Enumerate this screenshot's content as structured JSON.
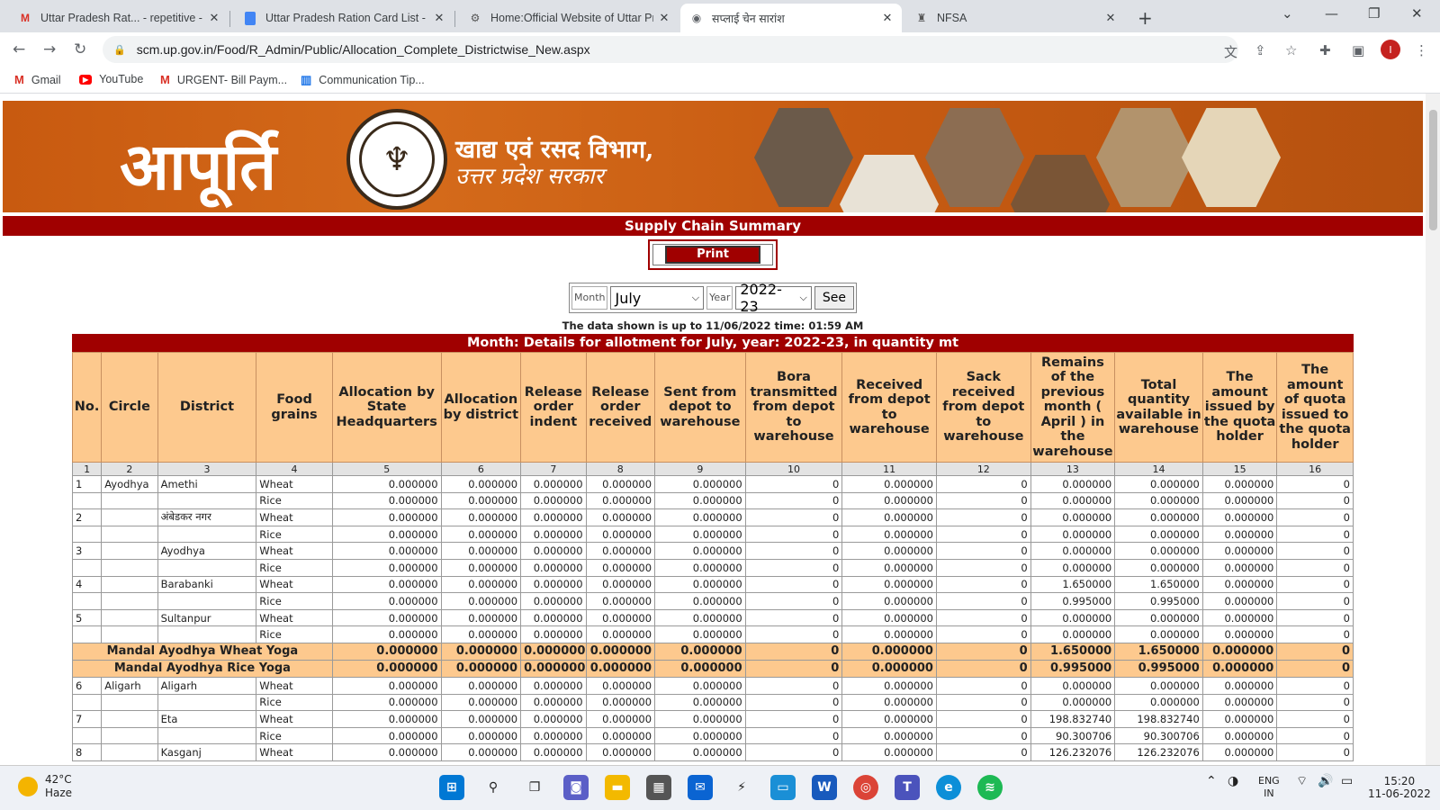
{
  "browser": {
    "tabs": [
      {
        "title": "Uttar Pradesh Rat... - repetitive -",
        "icon": "gmail-icon",
        "active": false
      },
      {
        "title": "Uttar Pradesh Ration Card List - C",
        "icon": "docs-icon",
        "active": false
      },
      {
        "title": "Home:Official Website of Uttar Pr",
        "icon": "emblem-icon",
        "active": false
      },
      {
        "title": "सप्लाई चेन सारांश",
        "icon": "globe-icon",
        "active": true
      },
      {
        "title": "NFSA",
        "icon": "emblem-icon",
        "active": false
      }
    ],
    "url": "scm.up.gov.in/Food/R_Admin/Public/Allocation_Complete_Districtwise_New.aspx",
    "profile_initial": "I",
    "bookmarks": [
      {
        "label": "Gmail",
        "icon": "gmail-icon"
      },
      {
        "label": "YouTube",
        "icon": "youtube-icon"
      },
      {
        "label": "URGENT- Bill Paym...",
        "icon": "gmail-icon"
      },
      {
        "label": "Communication Tip...",
        "icon": "chart-icon"
      }
    ]
  },
  "banner": {
    "logo_text": "आपूर्ति",
    "dept_line1": "खाद्य एवं रसद विभाग,",
    "dept_line2": "उत्तर प्रदेश सरकार"
  },
  "page": {
    "title": "Supply Chain Summary",
    "print_label": "Print",
    "month_label": "Month",
    "month_value": "July",
    "year_label": "Year",
    "year_value": "2022-23",
    "see_label": "See",
    "as_of": "The data shown is up to 11/06/2022 time: 01:59 AM",
    "table_caption": "Month: Details for allotment for July, year: 2022-23, in quantity mt"
  },
  "table": {
    "headers": [
      "No.",
      "Circle",
      "District",
      "Food grains",
      "Allocation by State Headquarters",
      "Allocation by district",
      "Release order indent",
      "Release order received",
      "Sent from depot to warehouse",
      "Bora transmitted from depot to warehouse",
      "Received from depot to warehouse",
      "Sack received from depot to warehouse",
      "Remains of the previous month ( April ) in the warehouse",
      "Total quantity available in warehouse",
      "The amount issued by the quota holder",
      "The amount of quota issued to the quota holder"
    ],
    "col_numbers": [
      "1",
      "2",
      "3",
      "4",
      "5",
      "6",
      "7",
      "8",
      "9",
      "10",
      "11",
      "12",
      "13",
      "14",
      "15",
      "16"
    ],
    "rows": [
      {
        "type": "data",
        "cells": [
          "1",
          "Ayodhya",
          "Amethi",
          "Wheat",
          "0.000000",
          "0.000000",
          "0.000000",
          "0.000000",
          "0.000000",
          "0",
          "0.000000",
          "0",
          "0.000000",
          "0.000000",
          "0.000000",
          "0"
        ]
      },
      {
        "type": "data",
        "cells": [
          "",
          "",
          "",
          "Rice",
          "0.000000",
          "0.000000",
          "0.000000",
          "0.000000",
          "0.000000",
          "0",
          "0.000000",
          "0",
          "0.000000",
          "0.000000",
          "0.000000",
          "0"
        ]
      },
      {
        "type": "data",
        "cells": [
          "2",
          "",
          "अंबेडकर नगर",
          "Wheat",
          "0.000000",
          "0.000000",
          "0.000000",
          "0.000000",
          "0.000000",
          "0",
          "0.000000",
          "0",
          "0.000000",
          "0.000000",
          "0.000000",
          "0"
        ]
      },
      {
        "type": "data",
        "cells": [
          "",
          "",
          "",
          "Rice",
          "0.000000",
          "0.000000",
          "0.000000",
          "0.000000",
          "0.000000",
          "0",
          "0.000000",
          "0",
          "0.000000",
          "0.000000",
          "0.000000",
          "0"
        ]
      },
      {
        "type": "data",
        "cells": [
          "3",
          "",
          "Ayodhya",
          "Wheat",
          "0.000000",
          "0.000000",
          "0.000000",
          "0.000000",
          "0.000000",
          "0",
          "0.000000",
          "0",
          "0.000000",
          "0.000000",
          "0.000000",
          "0"
        ]
      },
      {
        "type": "data",
        "cells": [
          "",
          "",
          "",
          "Rice",
          "0.000000",
          "0.000000",
          "0.000000",
          "0.000000",
          "0.000000",
          "0",
          "0.000000",
          "0",
          "0.000000",
          "0.000000",
          "0.000000",
          "0"
        ]
      },
      {
        "type": "data",
        "cells": [
          "4",
          "",
          "Barabanki",
          "Wheat",
          "0.000000",
          "0.000000",
          "0.000000",
          "0.000000",
          "0.000000",
          "0",
          "0.000000",
          "0",
          "1.650000",
          "1.650000",
          "0.000000",
          "0"
        ]
      },
      {
        "type": "data",
        "cells": [
          "",
          "",
          "",
          "Rice",
          "0.000000",
          "0.000000",
          "0.000000",
          "0.000000",
          "0.000000",
          "0",
          "0.000000",
          "0",
          "0.995000",
          "0.995000",
          "0.000000",
          "0"
        ]
      },
      {
        "type": "data",
        "cells": [
          "5",
          "",
          "Sultanpur",
          "Wheat",
          "0.000000",
          "0.000000",
          "0.000000",
          "0.000000",
          "0.000000",
          "0",
          "0.000000",
          "0",
          "0.000000",
          "0.000000",
          "0.000000",
          "0"
        ]
      },
      {
        "type": "data",
        "cells": [
          "",
          "",
          "",
          "Rice",
          "0.000000",
          "0.000000",
          "0.000000",
          "0.000000",
          "0.000000",
          "0",
          "0.000000",
          "0",
          "0.000000",
          "0.000000",
          "0.000000",
          "0"
        ]
      },
      {
        "type": "sum",
        "label": "Mandal Ayodhya Wheat Yoga",
        "cells": [
          "0.000000",
          "0.000000",
          "0.000000",
          "0.000000",
          "0.000000",
          "0",
          "0.000000",
          "0",
          "1.650000",
          "1.650000",
          "0.000000",
          "0"
        ]
      },
      {
        "type": "sum",
        "label": "Mandal Ayodhya Rice Yoga",
        "cells": [
          "0.000000",
          "0.000000",
          "0.000000",
          "0.000000",
          "0.000000",
          "0",
          "0.000000",
          "0",
          "0.995000",
          "0.995000",
          "0.000000",
          "0"
        ]
      },
      {
        "type": "data",
        "cells": [
          "6",
          "Aligarh",
          "Aligarh",
          "Wheat",
          "0.000000",
          "0.000000",
          "0.000000",
          "0.000000",
          "0.000000",
          "0",
          "0.000000",
          "0",
          "0.000000",
          "0.000000",
          "0.000000",
          "0"
        ]
      },
      {
        "type": "data",
        "cells": [
          "",
          "",
          "",
          "Rice",
          "0.000000",
          "0.000000",
          "0.000000",
          "0.000000",
          "0.000000",
          "0",
          "0.000000",
          "0",
          "0.000000",
          "0.000000",
          "0.000000",
          "0"
        ]
      },
      {
        "type": "data",
        "cells": [
          "7",
          "",
          "Eta",
          "Wheat",
          "0.000000",
          "0.000000",
          "0.000000",
          "0.000000",
          "0.000000",
          "0",
          "0.000000",
          "0",
          "198.832740",
          "198.832740",
          "0.000000",
          "0"
        ]
      },
      {
        "type": "data",
        "cells": [
          "",
          "",
          "",
          "Rice",
          "0.000000",
          "0.000000",
          "0.000000",
          "0.000000",
          "0.000000",
          "0",
          "0.000000",
          "0",
          "90.300706",
          "90.300706",
          "0.000000",
          "0"
        ]
      },
      {
        "type": "data",
        "cells": [
          "8",
          "",
          "Kasganj",
          "Wheat",
          "0.000000",
          "0.000000",
          "0.000000",
          "0.000000",
          "0.000000",
          "0",
          "0.000000",
          "0",
          "126.232076",
          "126.232076",
          "0.000000",
          "0"
        ]
      }
    ]
  },
  "taskbar": {
    "temp": "42°C",
    "weather": "Haze",
    "lang1": "ENG",
    "lang2": "IN",
    "time": "15:20",
    "date": "11-06-2022"
  }
}
